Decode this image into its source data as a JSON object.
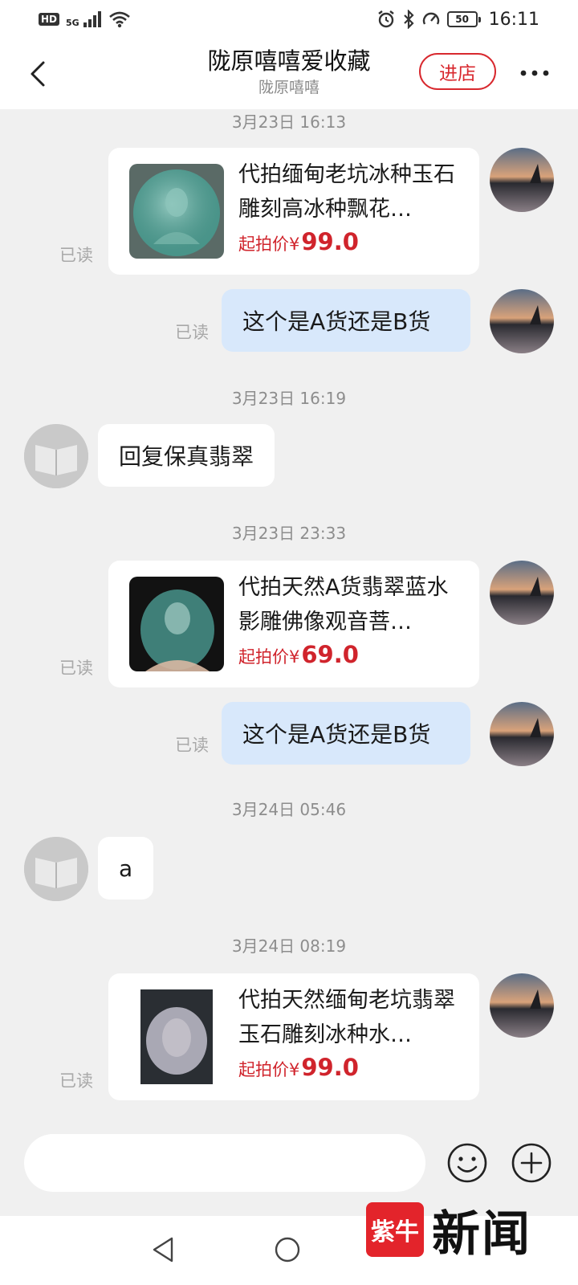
{
  "status_bar": {
    "hd": "HD",
    "network": "5G",
    "battery": "50",
    "time": "16:11"
  },
  "header": {
    "title": "陇原嘻嘻爱收藏",
    "subtitle": "陇原嘻嘻",
    "store_button": "进店"
  },
  "messages": {
    "t1": "3月23日 16:13",
    "card1": {
      "title": "代拍缅甸老坑冰种玉石雕刻高冰种飘花…",
      "price_label": "起拍价",
      "currency": "¥",
      "price": "99.0",
      "read": "已读"
    },
    "msg1": {
      "text": "这个是A货还是B货",
      "read": "已读"
    },
    "t2": "3月23日 16:19",
    "reply1": "回复保真翡翠",
    "t3": "3月23日 23:33",
    "card2": {
      "title": "代拍天然A货翡翠蓝水影雕佛像观音菩…",
      "price_label": "起拍价",
      "currency": "¥",
      "price": "69.0",
      "read": "已读"
    },
    "msg2": {
      "text": "这个是A货还是B货",
      "read": "已读"
    },
    "t4": "3月24日 05:46",
    "reply2": "a",
    "t5": "3月24日 08:19",
    "card3": {
      "title": "代拍天然缅甸老坑翡翠玉石雕刻冰种水…",
      "price_label": "起拍价",
      "currency": "¥",
      "price": "99.0",
      "read": "已读"
    }
  },
  "input": {
    "placeholder": ""
  },
  "watermark": {
    "logo": "紫牛",
    "text": "新闻"
  },
  "colors": {
    "accent": "#d8282e",
    "self_bubble": "#d8e8fb",
    "background": "#f0f0f0"
  }
}
